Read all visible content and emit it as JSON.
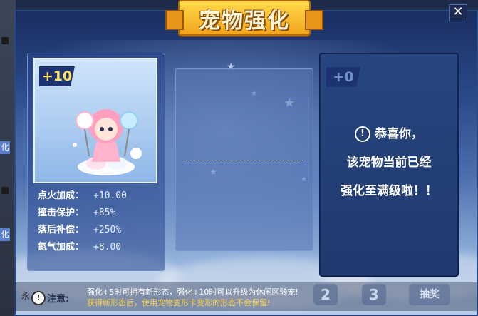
{
  "window": {
    "title": "宠物强化",
    "close_label": "✕"
  },
  "left_strip": {
    "tab_1": "化",
    "tab_2": "化"
  },
  "current_pet": {
    "level_badge": "+10",
    "stats": [
      {
        "label": "点火加成：",
        "value": "+10.00"
      },
      {
        "label": "撞击保护：",
        "value": "+85%"
      },
      {
        "label": "落后补偿：",
        "value": "+250%"
      },
      {
        "label": "氮气加成：",
        "value": "+8.00"
      }
    ]
  },
  "result_pet": {
    "level_badge": "+0",
    "message_line1": "恭喜你，",
    "message_line2": "该宠物当前已经",
    "message_line3": "强化至满级啦！！",
    "warn_icon": "!"
  },
  "notice": {
    "side_text": "永",
    "icon": "!",
    "label": "注意:",
    "line1": "强化+5时可拥有新形态，强化+10时可以升级为休闲区骑宠!",
    "line2": "获得新形态后，使用宠物变形卡变形的形态不会保留!"
  },
  "bottom_buttons": {
    "step_2": "2",
    "step_3": "3",
    "draw": "抽奖"
  },
  "colors": {
    "banner_gold": "#f2a51c",
    "badge_text": "#ffe45c",
    "notice_highlight": "#ffd34a"
  }
}
